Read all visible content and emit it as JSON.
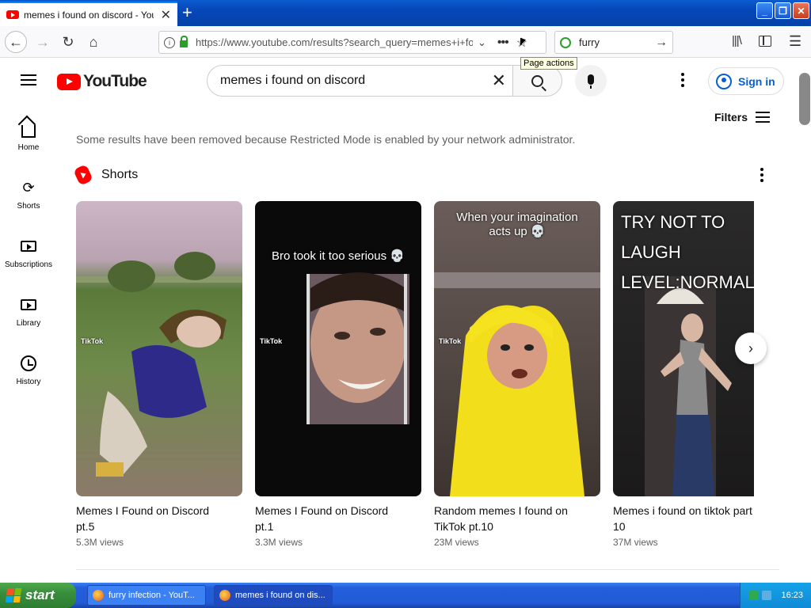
{
  "browser": {
    "tab_title": "memes i found on discord - YouTube",
    "tab_close": "✕",
    "new_tab": "+",
    "url": "https://www.youtube.com/results?search_query=memes+i+found+on+discord",
    "search_value": "furry",
    "tooltip": "Page actions",
    "more_label": "•••",
    "window": {
      "minimize": "_",
      "maximize": "❐",
      "close": "✕"
    }
  },
  "youtube": {
    "logo_text": "YouTube",
    "search_query": "memes i found on discord",
    "sign_in": "Sign in",
    "filters": "Filters",
    "notice": "Some results have been removed because Restricted Mode is enabled by your network administrator.",
    "guide": [
      {
        "label": "Home",
        "icon": "home-icon"
      },
      {
        "label": "Shorts",
        "icon": "shorts-icon"
      },
      {
        "label": "Subscriptions",
        "icon": "subscriptions-icon"
      },
      {
        "label": "Library",
        "icon": "library-icon"
      },
      {
        "label": "History",
        "icon": "history-icon"
      }
    ],
    "shorts": {
      "title": "Shorts",
      "items": [
        {
          "title": "Memes I Found on Discord\npt.5",
          "views": "5.3M views",
          "caption": "",
          "tiktok": "TikTok"
        },
        {
          "title": "Memes I Found on Discord\npt.1",
          "views": "3.3M views",
          "caption": "Bro took it too serious 💀",
          "tiktok": "TikTok"
        },
        {
          "title": "Random memes I found on\nTikTok pt.10",
          "views": "23M views",
          "caption": "When your imagination\nacts up 💀",
          "tiktok": "TikTok"
        },
        {
          "title": "Memes i found on tiktok part\n10",
          "views": "37M views",
          "caption": "TRY NOT TO LAUGH\nLEVEL:NORMAL",
          "tiktok": ""
        }
      ]
    }
  },
  "taskbar": {
    "start": "start",
    "tasks": [
      {
        "label": "furry infection - YouT..."
      },
      {
        "label": "memes i found on dis..."
      }
    ],
    "clock": "16:23"
  },
  "colors": {
    "youtube_red": "#ff0000",
    "link_blue": "#065fd4",
    "xp_taskbar": "#245edb",
    "xp_start": "#388e3c"
  }
}
